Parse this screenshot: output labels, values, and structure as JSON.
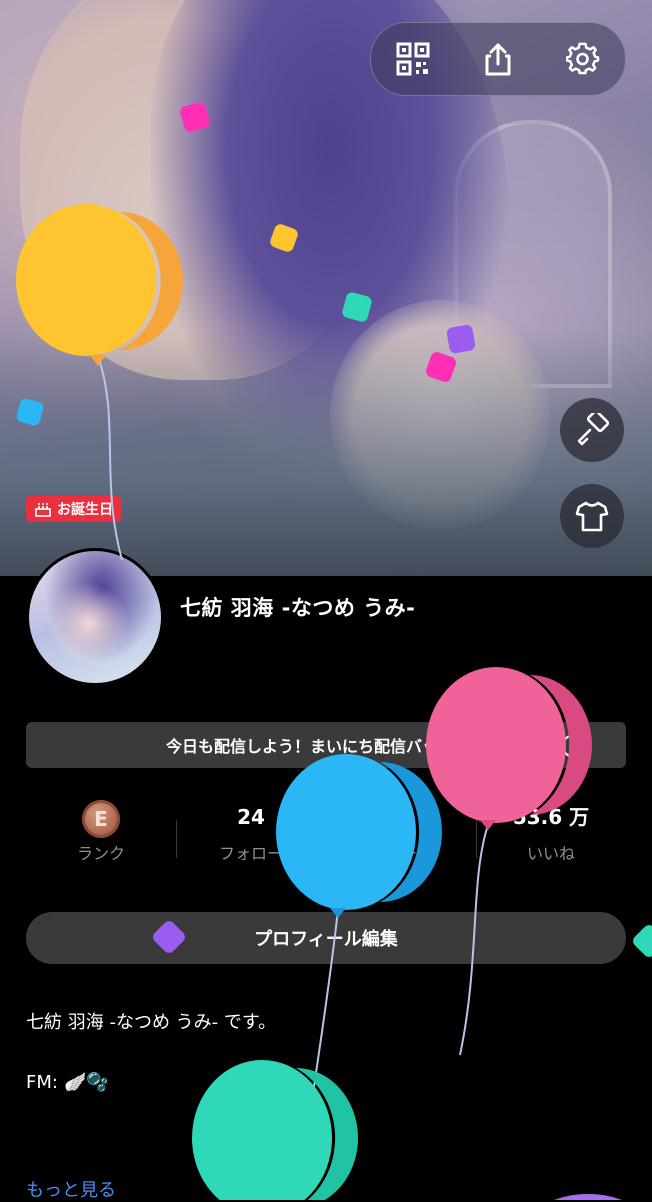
{
  "header": {
    "birthday_badge": "お誕生日",
    "actions": [
      "qr-code-icon",
      "share-icon",
      "gear-icon"
    ],
    "side_actions": [
      "paint-roller-icon",
      "tshirt-icon"
    ]
  },
  "profile": {
    "name": "七紡 羽海 -なつめ うみ-",
    "notice": "今日も配信しよう！まいにち配信バッジ獲得",
    "notice_help": "?",
    "stats": [
      {
        "value": "E",
        "label": "ランク"
      },
      {
        "value": "24",
        "label": "フォロー"
      },
      {
        "value": "",
        "label": "ワー"
      },
      {
        "value": "53.6 万",
        "label": "いいね"
      }
    ],
    "edit_button": "プロフィール編集",
    "bio": "七紡 羽海 -なつめ うみ- です。",
    "fm_label": "FM:",
    "fm_emojis": "🪽🫧",
    "more_link": "もっと見る"
  },
  "colors": {
    "background": "#000000",
    "button_bg": "#3a3a3a",
    "birthday_red": "#e8303f",
    "link_blue": "#4a8df0",
    "balloon_yellow": "#ffc530",
    "balloon_blue": "#2bb6f5",
    "balloon_pink": "#f0629a",
    "balloon_green": "#2fd9b8"
  }
}
